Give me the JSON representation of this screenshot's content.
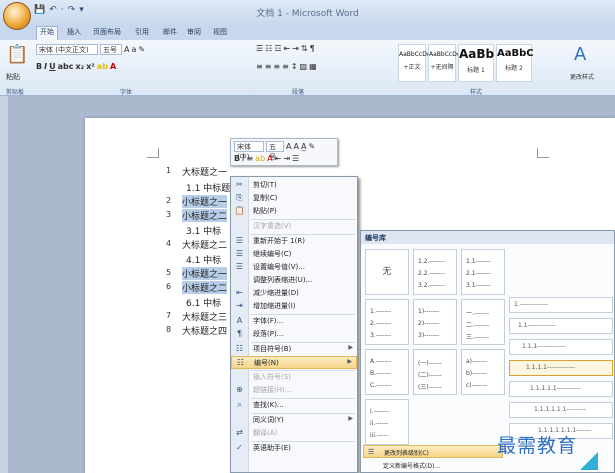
{
  "window": {
    "title": "文档 1 - Microsoft Word"
  },
  "qat": {
    "items": [
      "💾",
      "↶",
      "·",
      "↷",
      "▾"
    ]
  },
  "tabs": [
    "开始",
    "插入",
    "页面布局",
    "引用",
    "邮件",
    "审阅",
    "视图"
  ],
  "ribbon": {
    "paste_label": "粘贴",
    "font_name": "宋体 (中文正文)",
    "font_size": "五号",
    "groups": [
      "剪贴板",
      "字体",
      "段落",
      "样式"
    ],
    "styles": [
      {
        "sample": "AaBbCcDd",
        "name": "+正文"
      },
      {
        "sample": "AaBbCcDd",
        "name": "+无间隔"
      },
      {
        "sample": "AaBb",
        "name": "标题 1"
      },
      {
        "sample": "AaBbC",
        "name": "标题 2"
      }
    ],
    "change_styles_label": "更改样式"
  },
  "document": {
    "lines": [
      {
        "num": "1",
        "text": "大标题之一"
      },
      {
        "num": "",
        "text": "1.1  中标题"
      },
      {
        "num": "2",
        "text": "小标题之一"
      },
      {
        "num": "3",
        "text": "小标题之二"
      },
      {
        "num": "",
        "text": "3.1  中标"
      },
      {
        "num": "4",
        "text": "大标题之二"
      },
      {
        "num": "",
        "text": "4.1  中标"
      },
      {
        "num": "5",
        "text": "小标题之一"
      },
      {
        "num": "6",
        "text": "小标题之二"
      },
      {
        "num": "",
        "text": "6.1  中标"
      },
      {
        "num": "7",
        "text": "大标题之三"
      },
      {
        "num": "8",
        "text": "大标题之四"
      }
    ]
  },
  "mini_toolbar": {
    "font": "宋体 (中)",
    "size": "五号",
    "row1_icons": [
      "A",
      "A",
      "A̲",
      "✎"
    ],
    "row2_icons": [
      "B",
      "I",
      "≡",
      "ab",
      "A",
      "⇤",
      "⇥",
      "☰"
    ]
  },
  "context_menu": {
    "items": [
      {
        "icon": "✂",
        "label": "剪切(T)",
        "disabled": false,
        "arrow": false
      },
      {
        "icon": "⎘",
        "label": "复制(C)",
        "disabled": false,
        "arrow": false
      },
      {
        "icon": "📋",
        "label": "粘贴(P)",
        "disabled": false,
        "arrow": false
      },
      {
        "icon": "",
        "label": "汉字重选(V)",
        "disabled": true,
        "arrow": false
      },
      {
        "icon": "☰",
        "label": "重新开始于 1(R)",
        "disabled": false,
        "arrow": false
      },
      {
        "icon": "☰",
        "label": "继续编号(C)",
        "disabled": false,
        "arrow": false
      },
      {
        "icon": "☰",
        "label": "设置编号值(V)...",
        "disabled": false,
        "arrow": false
      },
      {
        "icon": "",
        "label": "调整列表缩进(U)...",
        "disabled": false,
        "arrow": false
      },
      {
        "icon": "⇤",
        "label": "减少缩进量(D)",
        "disabled": false,
        "arrow": false
      },
      {
        "icon": "⇥",
        "label": "增加缩进量(I)",
        "disabled": false,
        "arrow": false
      },
      {
        "icon": "A",
        "label": "字体(F)...",
        "disabled": false,
        "arrow": false
      },
      {
        "icon": "¶",
        "label": "段落(P)...",
        "disabled": false,
        "arrow": false
      },
      {
        "icon": "☷",
        "label": "项目符号(B)",
        "disabled": false,
        "arrow": true
      },
      {
        "icon": "☷",
        "label": "编号(N)",
        "disabled": false,
        "arrow": true,
        "highlighted": true
      },
      {
        "icon": "",
        "label": "插入符号(S)",
        "disabled": true,
        "arrow": false
      },
      {
        "icon": "⊕",
        "label": "超链接(H)...",
        "disabled": true,
        "arrow": false
      },
      {
        "icon": "⌕",
        "label": "查找(K)...",
        "disabled": false,
        "arrow": false
      },
      {
        "icon": "",
        "label": "同义词(Y)",
        "disabled": false,
        "arrow": true
      },
      {
        "icon": "⇄",
        "label": "翻译(A)",
        "disabled": true,
        "arrow": false
      },
      {
        "icon": "✓",
        "label": "英语助手(E)",
        "disabled": false,
        "arrow": false
      }
    ]
  },
  "numbering_library": {
    "header": "编号库",
    "none_label": "无",
    "cells": [
      {
        "rows": [
          "1.2.-------",
          "2.2.-------",
          "3.2.-------"
        ]
      },
      {
        "rows": [
          "1.1-------",
          "2.1-------",
          "3.1-------"
        ]
      },
      {
        "rows": [
          "1.-------",
          "2.-------",
          "3.-------"
        ]
      },
      {
        "rows": [
          "1)-------",
          "2)-------",
          "3)-------"
        ]
      },
      {
        "rows": [
          "一.-------",
          "二.-------",
          "三.-------"
        ]
      },
      {
        "rows": [
          "A.-------",
          "B.-------",
          "C.-------"
        ]
      },
      {
        "rows": [
          "(一)------",
          "(二)------",
          "(三)------"
        ]
      },
      {
        "rows": [
          "a)-------",
          "b)-------",
          "c)-------"
        ]
      },
      {
        "rows": [
          "i.-------",
          "ii.------",
          "iii.-----"
        ]
      }
    ],
    "levels": [
      "1.-------------",
      "1.1-------------",
      "1.1.1-------------",
      "1.1.1.1-------------",
      "1.1.1.1.1-----------",
      "1.1.1.1.1.1---------",
      "1.1.1.1.1.1.1-------"
    ],
    "bottom_items": [
      {
        "icon": "☰",
        "label": "更改列表级别(C)",
        "highlighted": true
      },
      {
        "icon": "",
        "label": "定义新编号格式(D)...",
        "highlighted": false
      }
    ]
  },
  "watermark": {
    "text": "最需教育"
  },
  "colors": {
    "accent": "#2f6fc0",
    "highlight": "#f6d58a",
    "selection": "#b8cde8"
  }
}
